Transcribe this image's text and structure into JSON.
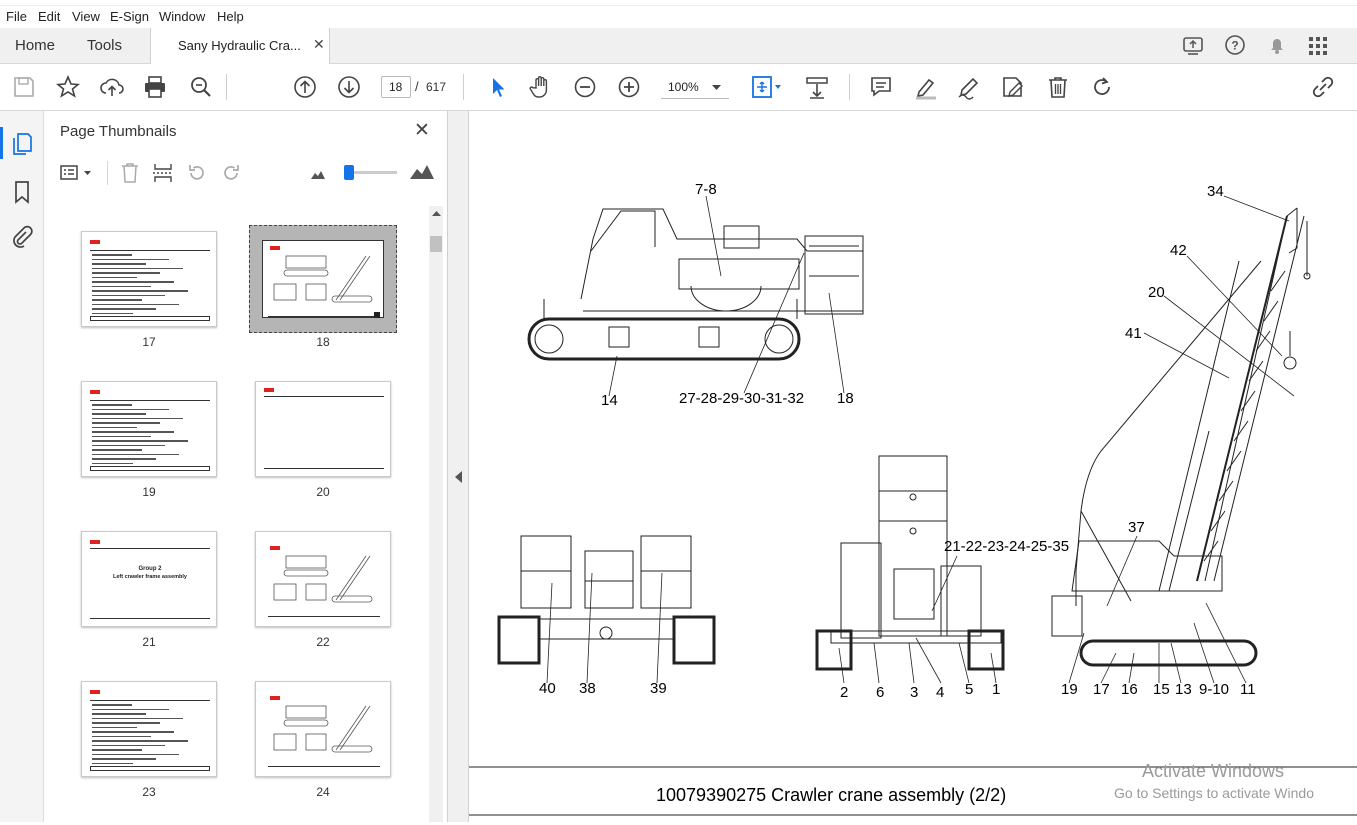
{
  "menu": {
    "items": [
      "File",
      "Edit",
      "View",
      "E-Sign",
      "Window",
      "Help"
    ]
  },
  "tabs": {
    "home": "Home",
    "tools": "Tools",
    "document": "Sany Hydraulic Cra..."
  },
  "toolbar": {
    "current_page": "18",
    "page_separator": "/",
    "page_count": "617",
    "zoom": "100%"
  },
  "panel": {
    "title": "Page Thumbnails",
    "thumbnails": [
      {
        "label": "17",
        "kind": "parts-list"
      },
      {
        "label": "18",
        "kind": "drawing",
        "selected": true
      },
      {
        "label": "19",
        "kind": "parts-list"
      },
      {
        "label": "20",
        "kind": "blank"
      },
      {
        "label": "21",
        "kind": "group-title",
        "line1": "Group 2",
        "line2": "Left crawler frame assembly"
      },
      {
        "label": "22",
        "kind": "drawing"
      },
      {
        "label": "23",
        "kind": "parts-list"
      },
      {
        "label": "24",
        "kind": "drawing"
      }
    ]
  },
  "drawing": {
    "callouts": [
      "7-8",
      "14",
      "27-28-29-30-31-32",
      "18",
      "34",
      "42",
      "20",
      "41",
      "37",
      "21-22-23-24-25-35",
      "40",
      "38",
      "39",
      "2",
      "6",
      "3",
      "4",
      "5",
      "1",
      "19",
      "17",
      "16",
      "15",
      "13",
      "9-10",
      "11"
    ],
    "caption": "10079390275 Crawler crane assembly (2/2)"
  },
  "watermark": {
    "line1": "Activate Windows",
    "line2": "Go to Settings to activate Windo"
  },
  "colors": {
    "accent": "#1473e6",
    "selected_thumb_bg": "#b5b5b5",
    "panel_bg": "#f4f4f4"
  }
}
